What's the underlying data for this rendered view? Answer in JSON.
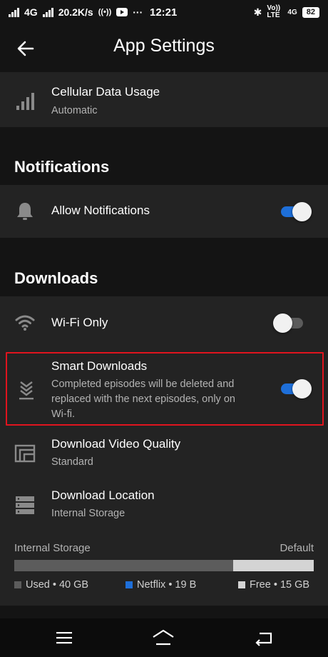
{
  "status_bar": {
    "network": "4G",
    "speed": "20.2K/s",
    "more": "···",
    "time": "12:21",
    "volte": "Vo)) LTE",
    "net2": "4G",
    "battery": "82"
  },
  "app_bar": {
    "title": "App Settings",
    "back_icon": "arrow-left-icon"
  },
  "cellular": {
    "title": "Cellular Data Usage",
    "value": "Automatic",
    "icon": "signal-bars-icon"
  },
  "notifications": {
    "header": "Notifications",
    "allow": {
      "title": "Allow Notifications",
      "on": true,
      "icon": "bell-icon"
    }
  },
  "downloads": {
    "header": "Downloads",
    "wifi_only": {
      "title": "Wi-Fi Only",
      "on": false,
      "icon": "wifi-icon"
    },
    "smart": {
      "title": "Smart Downloads",
      "description_line1": "Completed episodes will be deleted and",
      "description_line2": "replaced with the next episodes, only on",
      "description_line3": "Wi-fi.",
      "on": true,
      "icon": "smart-download-icon"
    },
    "quality": {
      "title": "Download Video Quality",
      "value": "Standard",
      "icon": "video-quality-icon"
    },
    "location": {
      "title": "Download Location",
      "value": "Internal Storage",
      "icon": "storage-icon"
    }
  },
  "storage": {
    "label": "Internal Storage",
    "default_label": "Default",
    "used_fraction": 0.73,
    "legend": {
      "used": "Used • 40 GB",
      "netflix": "Netflix • 19 B",
      "free": "Free • 15 GB"
    },
    "colors": {
      "used": "#5c5c5c",
      "netflix": "#1e6fd9",
      "free": "#d4d4d4"
    }
  },
  "colors": {
    "accent": "#1e6fd9",
    "highlight": "#e0141e",
    "card": "#232323",
    "background": "#141414"
  }
}
